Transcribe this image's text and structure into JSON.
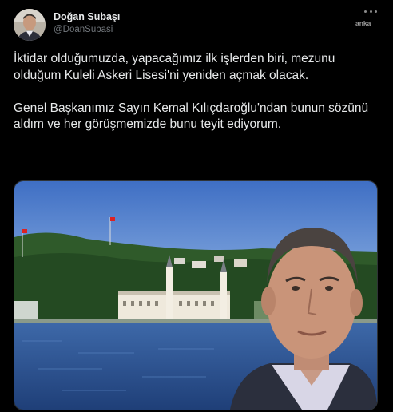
{
  "author": {
    "name": "Doğan Subaşı",
    "handle": "@DoanSubasi"
  },
  "watermark": "anka",
  "more_icon": "more-dots-icon",
  "tweet_text": "İktidar olduğumuzda, yapacağımız ilk işlerden biri, mezunu olduğum Kuleli Askeri Lisesi'ni yeniden açmak olacak.\n\nGenel Başkanımız Sayın Kemal Kılıçdaroğlu'ndan bunun sözünü aldım ve her görüşmemizde bunu teyit ediyorum.",
  "colors": {
    "background": "#000000",
    "name": "#e7e9ea",
    "handle": "#71767b",
    "text": "#e7e9ea"
  }
}
